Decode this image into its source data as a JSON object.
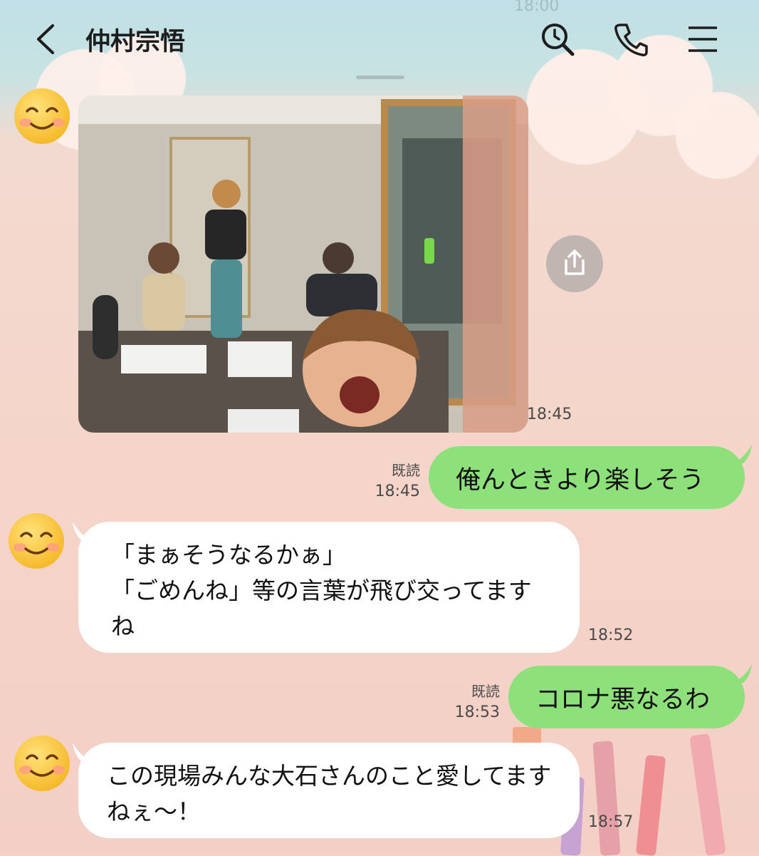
{
  "header": {
    "title": "仲村宗悟",
    "faint_time": "18:00"
  },
  "photo_message": {
    "time": "18:45",
    "image_alt": "photo of four people in a recording studio"
  },
  "messages": [
    {
      "sender": "me",
      "text": "俺んときより楽しそう",
      "read_label": "既読",
      "time": "18:45"
    },
    {
      "sender": "them",
      "text": "「まぁそうなるかぁ」\n「ごめんね」等の言葉が飛び交ってますね",
      "time": "18:52"
    },
    {
      "sender": "me",
      "text": "コロナ悪なるわ",
      "read_label": "既読",
      "time": "18:53"
    },
    {
      "sender": "them",
      "text": "この現場みんな大石さんのこと愛してますねぇ〜！",
      "time": "18:57"
    }
  ],
  "colors": {
    "my_bubble": "#8de07a",
    "their_bubble": "#ffffff",
    "header_text": "#1d1d1d"
  },
  "icons": [
    "back-icon",
    "search-icon",
    "phone-icon",
    "menu-icon",
    "share-icon",
    "smiling-face-avatar"
  ]
}
